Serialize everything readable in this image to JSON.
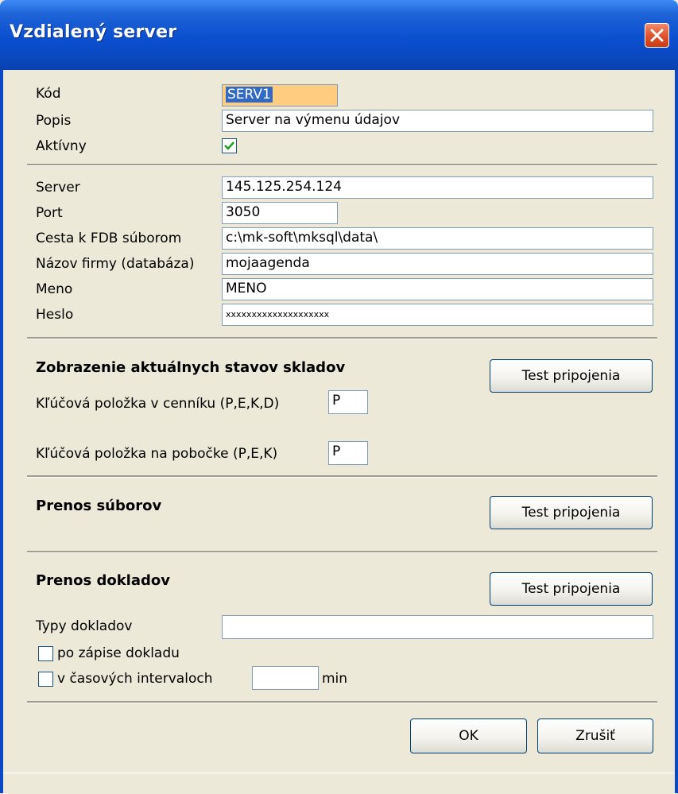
{
  "window": {
    "title": "Vzdialený server"
  },
  "general": {
    "code_label": "Kód",
    "code_value": "SERV1",
    "desc_label": "Popis",
    "desc_value": "Server na výmenu údajov",
    "active_label": "Aktívny",
    "active_checked": true
  },
  "connection": {
    "server_label": "Server",
    "server_value": "145.125.254.124",
    "port_label": "Port",
    "port_value": "3050",
    "path_label": "Cesta k FDB súborom",
    "path_value": "c:\\mk-soft\\mksql\\data\\",
    "company_label": "Názov firmy (databáza)",
    "company_value": "mojaagenda",
    "name_label": "Meno",
    "name_value": "MENO",
    "password_label": "Heslo",
    "password_value": "xxxxxxxxxxxxxxxxxxxx"
  },
  "stock": {
    "heading": "Zobrazenie aktuálnych stavov skladov",
    "test_button": "Test pripojenia",
    "pricelist_key_label": "Kľúčová položka v cenníku (P,E,K,D)",
    "pricelist_key_value": "P",
    "branch_key_label": "Kľúčová položka na pobočke (P,E,K)",
    "branch_key_value": "P"
  },
  "files": {
    "heading": "Prenos súborov",
    "test_button": "Test pripojenia"
  },
  "documents": {
    "heading": "Prenos dokladov",
    "test_button": "Test pripojenia",
    "types_label": "Typy dokladov",
    "types_value": "",
    "after_write_label": "po zápise dokladu",
    "after_write_checked": false,
    "interval_label": "v časových intervaloch",
    "interval_checked": false,
    "interval_value": "",
    "min_label": "min"
  },
  "actions": {
    "ok": "OK",
    "cancel": "Zrušiť"
  },
  "colors": {
    "titlebar": "#0a46bd",
    "highlight": "#ffcc80",
    "selection": "#316ac5",
    "check": "#21a121"
  }
}
